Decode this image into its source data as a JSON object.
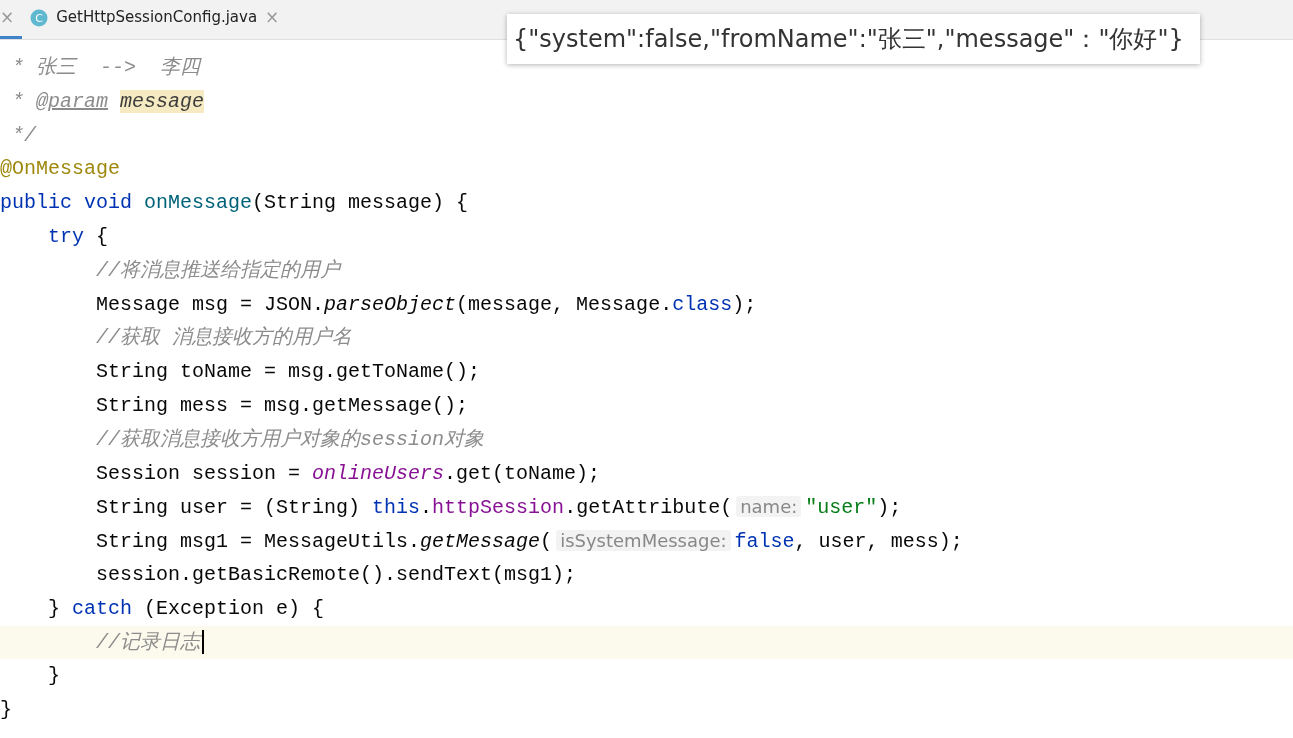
{
  "tabs": [
    {
      "close": "×",
      "selected": true
    },
    {
      "label": "GetHttpSessionConfig.java",
      "icon_letter": "C",
      "close": "×",
      "selected": false
    }
  ],
  "tooltip": {
    "text": "{\"system\":false,\"fromName\":\"张三\",\"message\"：\"你好\"}"
  },
  "code_lines": [
    {
      "current": false,
      "tokens": [
        {
          "kind": "comment",
          "text": " * 张三  -->  李四"
        }
      ]
    },
    {
      "current": false,
      "tokens": [
        {
          "kind": "comment",
          "text": " * "
        },
        {
          "kind": "doc_tag",
          "text": "@param"
        },
        {
          "kind": "doc_param",
          "text": "message"
        }
      ]
    },
    {
      "current": false,
      "tokens": [
        {
          "kind": "comment",
          "text": " */"
        }
      ]
    },
    {
      "current": false,
      "tokens": [
        {
          "kind": "annotation",
          "text": "@OnMessage"
        }
      ]
    },
    {
      "current": false,
      "tokens": [
        {
          "kind": "keyword",
          "text": "public void "
        },
        {
          "kind": "method",
          "text": "onMessage"
        },
        {
          "kind": "plain",
          "text": "(String message) {"
        }
      ]
    },
    {
      "current": false,
      "tokens": [
        {
          "kind": "keyword",
          "text": "    try "
        },
        {
          "kind": "plain",
          "text": "{"
        }
      ]
    },
    {
      "current": false,
      "tokens": [
        {
          "kind": "comment",
          "text": "        //将消息推送给指定的用户"
        }
      ]
    },
    {
      "current": false,
      "tokens": [
        {
          "kind": "plain",
          "text": "        Message msg = JSON."
        },
        {
          "kind": "static",
          "text": "parseObject"
        },
        {
          "kind": "plain",
          "text": "(message, Message."
        },
        {
          "kind": "keyword",
          "text": "class"
        },
        {
          "kind": "plain",
          "text": ");"
        }
      ]
    },
    {
      "current": false,
      "tokens": [
        {
          "kind": "comment",
          "text": "        //获取 消息接收方的用户名"
        }
      ]
    },
    {
      "current": false,
      "tokens": [
        {
          "kind": "plain",
          "text": "        String toName = msg.getToName();"
        }
      ]
    },
    {
      "current": false,
      "tokens": [
        {
          "kind": "plain",
          "text": "        String mess = msg.getMessage();"
        }
      ]
    },
    {
      "current": false,
      "tokens": [
        {
          "kind": "comment",
          "text": "        //获取消息接收方用户对象的session对象"
        }
      ]
    },
    {
      "current": false,
      "tokens": [
        {
          "kind": "plain",
          "text": "        Session session = "
        },
        {
          "kind": "static_field",
          "text": "onlineUsers"
        },
        {
          "kind": "plain",
          "text": ".get(toName);"
        }
      ]
    },
    {
      "current": false,
      "tokens": [
        {
          "kind": "plain",
          "text": "        String user = (String) "
        },
        {
          "kind": "keyword",
          "text": "this"
        },
        {
          "kind": "plain",
          "text": "."
        },
        {
          "kind": "field",
          "text": "httpSession"
        },
        {
          "kind": "plain",
          "text": ".getAttribute("
        },
        {
          "kind": "hint",
          "text": "name:"
        },
        {
          "kind": "string",
          "text": "\"user\""
        },
        {
          "kind": "plain",
          "text": ");"
        }
      ]
    },
    {
      "current": false,
      "tokens": [
        {
          "kind": "plain",
          "text": "        String msg1 = MessageUtils."
        },
        {
          "kind": "static",
          "text": "getMessage"
        },
        {
          "kind": "plain",
          "text": "("
        },
        {
          "kind": "hint",
          "text": "isSystemMessage:"
        },
        {
          "kind": "keyword",
          "text": "false"
        },
        {
          "kind": "plain",
          "text": ", user, mess);"
        }
      ]
    },
    {
      "current": false,
      "tokens": [
        {
          "kind": "plain",
          "text": "        session.getBasicRemote().sendText(msg1);"
        }
      ]
    },
    {
      "current": false,
      "tokens": [
        {
          "kind": "plain",
          "text": "    } "
        },
        {
          "kind": "keyword",
          "text": "catch "
        },
        {
          "kind": "plain",
          "text": "(Exception e) {"
        }
      ]
    },
    {
      "current": true,
      "tokens": [
        {
          "kind": "comment",
          "text": "        //记录日志"
        }
      ]
    },
    {
      "current": false,
      "tokens": [
        {
          "kind": "plain",
          "text": "    }"
        }
      ]
    },
    {
      "current": false,
      "tokens": [
        {
          "kind": "plain",
          "text": "}"
        }
      ]
    }
  ]
}
